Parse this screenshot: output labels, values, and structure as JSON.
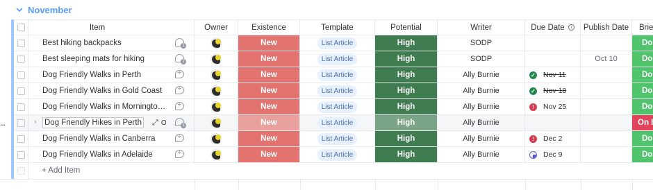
{
  "group": {
    "title": "November",
    "color": "#579bfc"
  },
  "columns": {
    "item": "Item",
    "owner": "Owner",
    "existence": "Existence",
    "template": "Template",
    "potential": "Potential",
    "writer": "Writer",
    "due_date": "Due Date",
    "publish_date": "Publish Date",
    "brief": "Briefe"
  },
  "rows": [
    {
      "name": "Best hiking backpacks",
      "update_count": "1",
      "existence": "New",
      "template": "List Article",
      "potential": "High",
      "writer": "SODP",
      "due": "",
      "due_icon": "",
      "due_strike": false,
      "publish": "",
      "brief": "Don"
    },
    {
      "name": "Best sleeping mats for hiking",
      "update_count": "2",
      "existence": "New",
      "template": "List Article",
      "potential": "High",
      "writer": "SODP",
      "due": "",
      "due_icon": "",
      "due_strike": false,
      "publish": "Oct 10",
      "brief": "Don"
    },
    {
      "name": "Dog Friendly Walks in Perth",
      "update_count": "",
      "existence": "New",
      "template": "List Article",
      "potential": "High",
      "writer": "Ally Burnie",
      "due": "Nov 11",
      "due_icon": "check",
      "due_strike": true,
      "publish": "",
      "brief": "Don"
    },
    {
      "name": "Dog Friendly Walks in Gold Coast",
      "update_count": "",
      "existence": "New",
      "template": "List Article",
      "potential": "High",
      "writer": "Ally Burnie",
      "due": "Nov 18",
      "due_icon": "check",
      "due_strike": true,
      "publish": "",
      "brief": "Don"
    },
    {
      "name": "Dog Friendly Walks in Mornington Penins...",
      "update_count": "",
      "existence": "New",
      "template": "List Article",
      "potential": "High",
      "writer": "Ally Burnie",
      "due": "Nov 25",
      "due_icon": "alert",
      "due_strike": false,
      "publish": "",
      "brief": "Don"
    },
    {
      "name": "Dog Friendly Hikes in Perth",
      "update_count": "1",
      "existence": "New",
      "template": "List Article",
      "potential": "High",
      "writer": "Ally Burnie",
      "due": "",
      "due_icon": "",
      "due_strike": false,
      "publish": "",
      "brief": "On Ho"
    },
    {
      "name": "Dog Friendly Walks in Canberra",
      "update_count": "",
      "existence": "New",
      "template": "List Article",
      "potential": "High",
      "writer": "Ally Burnie",
      "due": "Dec 2",
      "due_icon": "alert",
      "due_strike": false,
      "publish": "",
      "brief": "Don"
    },
    {
      "name": "Dog Friendly Walks in Adelaide",
      "update_count": "",
      "existence": "New",
      "template": "List Article",
      "potential": "High",
      "writer": "Ally Burnie",
      "due": "Dec 9",
      "due_icon": "clock",
      "due_strike": false,
      "publish": "",
      "brief": "Don"
    }
  ],
  "hovered_row": {
    "open_label": "Open"
  },
  "add_item_label": "+ Add Item",
  "side_menu": "...",
  "colors": {
    "new": "#e2736f",
    "high": "#3f7d50",
    "done": "#4fc46c",
    "on_hold": "#e2445c",
    "tag_bg": "#e6f0ff"
  }
}
